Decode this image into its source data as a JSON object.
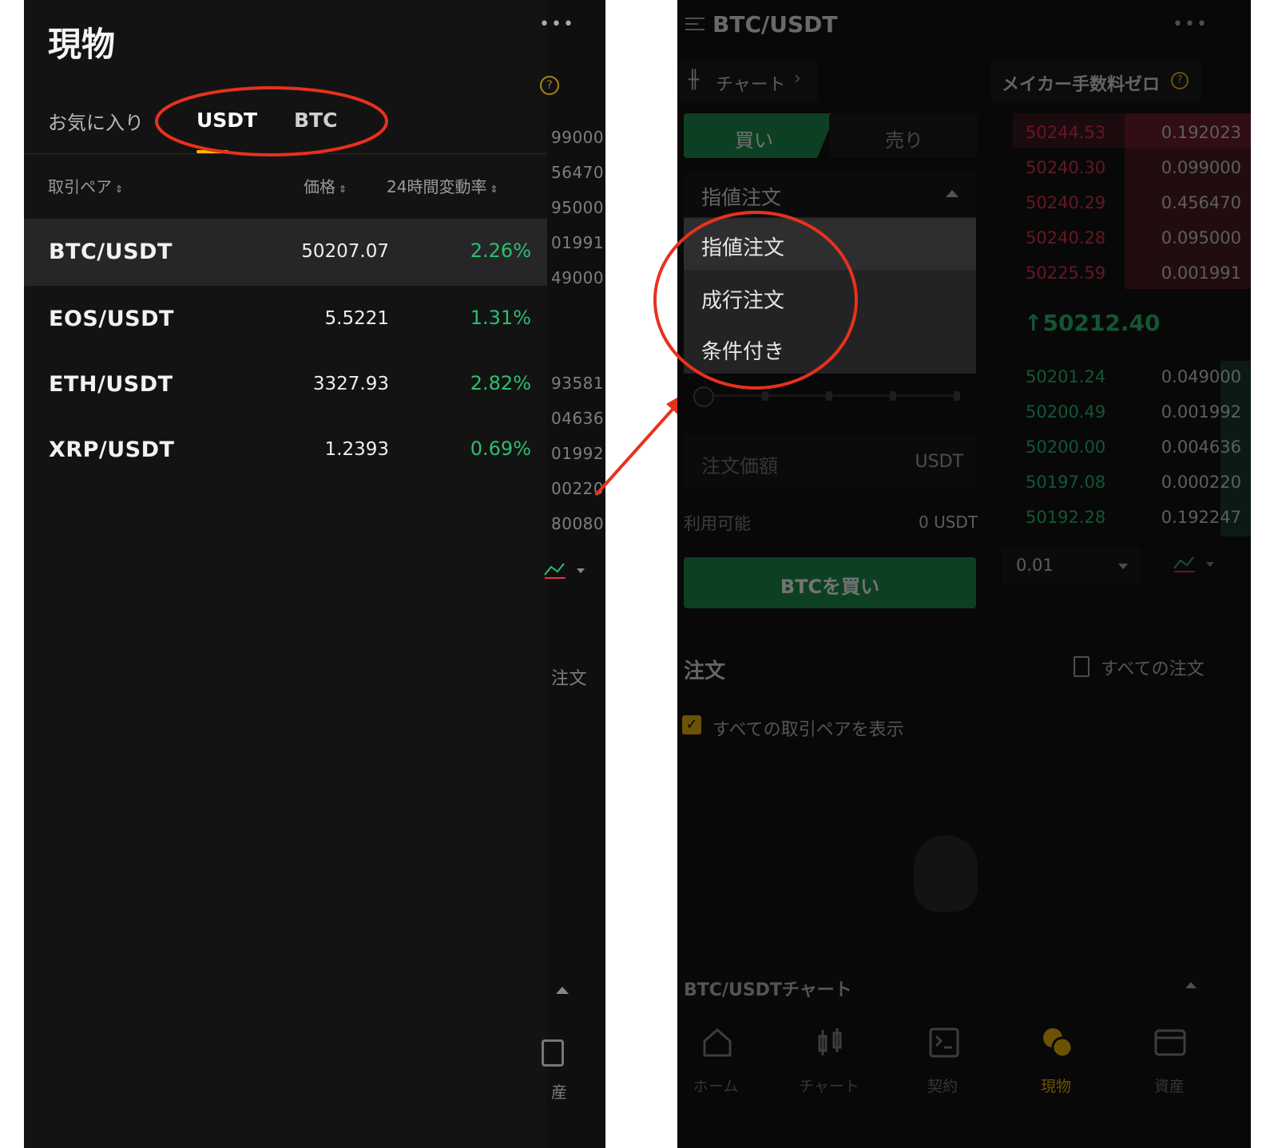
{
  "left": {
    "title": "現物",
    "more": "•••",
    "tabs": [
      "お気に入り",
      "USDT",
      "BTC"
    ],
    "columns": {
      "pair": "取引ペア",
      "price": "価格",
      "change": "24時間変動率"
    },
    "rows": [
      {
        "pair": "BTC/USDT",
        "price": "50207.07",
        "change": "2.26%"
      },
      {
        "pair": "EOS/USDT",
        "price": "5.5221",
        "change": "1.31%"
      },
      {
        "pair": "ETH/USDT",
        "price": "3327.93",
        "change": "2.82%"
      },
      {
        "pair": "XRP/USDT",
        "price": "1.2393",
        "change": "0.69%"
      }
    ],
    "strip": [
      "99000",
      "56470",
      "95000",
      "01991",
      "49000",
      "93581",
      "04636",
      "01992",
      "00220",
      "80080"
    ],
    "strip_order": "注文",
    "strip_assets": "産"
  },
  "right": {
    "pair": "BTC/USDT",
    "more": "•••",
    "chart_link": "チャート",
    "maker_fee": "メイカー手数料ゼロ",
    "buy_tab": "買い",
    "sell_tab": "売り",
    "order_type": "指値注文",
    "menu": [
      "指値注文",
      "成行注文",
      "条件付き"
    ],
    "price_field": {
      "placeholder": "注文価額",
      "unit": "USDT"
    },
    "available_label": "利用可能",
    "available_value": "0 USDT",
    "buy_button": "BTCを買い",
    "orders_title": "注文",
    "all_orders": "すべての注文",
    "show_all_pairs": "すべての取引ペアを表示",
    "chart_bar": "BTC/USDTチャート",
    "asks": [
      {
        "price": "50244.53",
        "qty": "0.192023"
      },
      {
        "price": "50240.30",
        "qty": "0.099000"
      },
      {
        "price": "50240.29",
        "qty": "0.456470"
      },
      {
        "price": "50240.28",
        "qty": "0.095000"
      },
      {
        "price": "50225.59",
        "qty": "0.001991"
      }
    ],
    "last_price": "50212.40",
    "bids": [
      {
        "price": "50201.24",
        "qty": "0.049000"
      },
      {
        "price": "50200.49",
        "qty": "0.001992"
      },
      {
        "price": "50200.00",
        "qty": "0.004636"
      },
      {
        "price": "50197.08",
        "qty": "0.000220"
      },
      {
        "price": "50192.28",
        "qty": "0.192247"
      }
    ],
    "depth": "0.01",
    "bottom_nav": [
      "ホーム",
      "チャート",
      "契約",
      "現物",
      "資産"
    ]
  },
  "colors": {
    "up": "#2ebd6f",
    "down": "#e0344a",
    "accent": "#f0b90b",
    "annotation": "#e8311c"
  }
}
